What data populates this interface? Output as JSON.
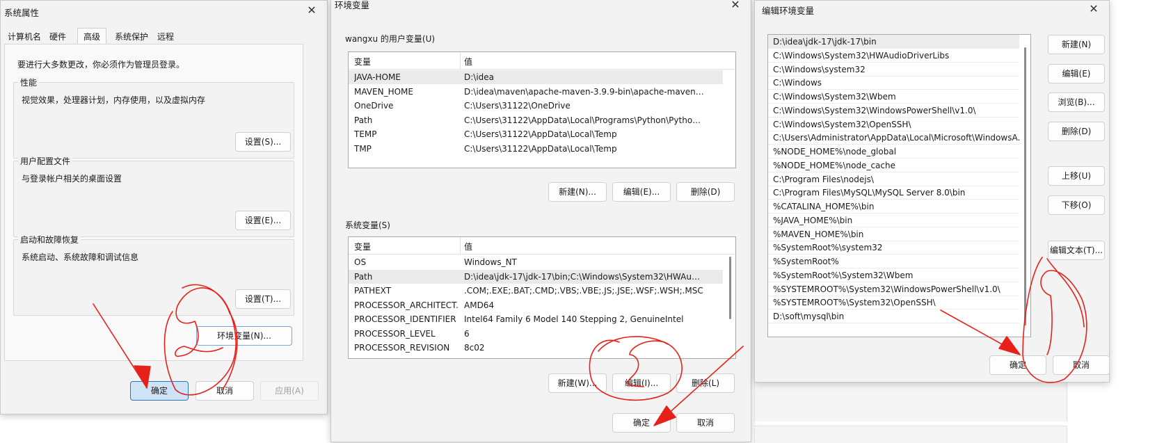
{
  "system_properties": {
    "title": "系统属性",
    "tabs": [
      "计算机名",
      "硬件",
      "高级",
      "系统保护",
      "远程"
    ],
    "active_tab": "高级",
    "admin_note": "要进行大多数更改，你必须作为管理员登录。",
    "performance": {
      "label": "性能",
      "desc": "视觉效果，处理器计划，内存使用，以及虚拟内存",
      "button": "设置(S)..."
    },
    "user_profile": {
      "label": "用户配置文件",
      "desc": "与登录帐户相关的桌面设置",
      "button": "设置(E)..."
    },
    "startup": {
      "label": "启动和故障恢复",
      "desc": "系统启动、系统故障和调试信息",
      "button": "设置(T)..."
    },
    "env_button": "环境变量(N)...",
    "ok": "确定",
    "cancel": "取消",
    "apply": "应用(A)"
  },
  "env_vars": {
    "title": "环境变量",
    "user_section_label": "wangxu 的用户变量(U)",
    "col_var": "变量",
    "col_value": "值",
    "user_vars": [
      {
        "name": "JAVA-HOME",
        "value": "D:\\idea"
      },
      {
        "name": "MAVEN_HOME",
        "value": "D:\\idea\\maven\\apache-maven-3.9.9-bin\\apache-maven-3.9.9"
      },
      {
        "name": "OneDrive",
        "value": "C:\\Users\\31122\\OneDrive"
      },
      {
        "name": "Path",
        "value": "C:\\Users\\31122\\AppData\\Local\\Programs\\Python\\Python313\\..."
      },
      {
        "name": "TEMP",
        "value": "C:\\Users\\31122\\AppData\\Local\\Temp"
      },
      {
        "name": "TMP",
        "value": "C:\\Users\\31122\\AppData\\Local\\Temp"
      }
    ],
    "user_buttons": {
      "new": "新建(N)...",
      "edit": "编辑(E)...",
      "delete": "删除(D)"
    },
    "system_section_label": "系统变量(S)",
    "system_vars": [
      {
        "name": "OS",
        "value": "Windows_NT"
      },
      {
        "name": "Path",
        "value": "D:\\idea\\jdk-17\\jdk-17\\bin;C:\\Windows\\System32\\HWAudioDr..."
      },
      {
        "name": "PATHEXT",
        "value": ".COM;.EXE;.BAT;.CMD;.VBS;.VBE;.JS;.JSE;.WSF;.WSH;.MSC"
      },
      {
        "name": "PROCESSOR_ARCHITECT...",
        "value": "AMD64"
      },
      {
        "name": "PROCESSOR_IDENTIFIER",
        "value": "Intel64 Family 6 Model 140 Stepping 2, GenuineIntel"
      },
      {
        "name": "PROCESSOR_LEVEL",
        "value": "6"
      },
      {
        "name": "PROCESSOR_REVISION",
        "value": "8c02"
      }
    ],
    "system_buttons": {
      "new": "新建(W)...",
      "edit": "编辑(I)...",
      "delete": "删除(L)"
    },
    "ok": "确定",
    "cancel": "取消"
  },
  "edit_env": {
    "title": "编辑环境变量",
    "paths": [
      "D:\\idea\\jdk-17\\jdk-17\\bin",
      "C:\\Windows\\System32\\HWAudioDriverLibs",
      "C:\\Windows\\system32",
      "C:\\Windows",
      "C:\\Windows\\System32\\Wbem",
      "C:\\Windows\\System32\\WindowsPowerShell\\v1.0\\",
      "C:\\Windows\\System32\\OpenSSH\\",
      "C:\\Users\\Administrator\\AppData\\Local\\Microsoft\\WindowsA...",
      "%NODE_HOME%\\node_global",
      "%NODE_HOME%\\node_cache",
      "C:\\Program Files\\nodejs\\",
      "C:\\Program Files\\MySQL\\MySQL Server 8.0\\bin",
      "%CATALINA_HOME%\\bin",
      "%JAVA_HOME%\\bin",
      "%MAVEN_HOME%\\bin",
      "%SystemRoot%\\system32",
      "%SystemRoot%",
      "%SystemRoot%\\System32\\Wbem",
      "%SYSTEMROOT%\\System32\\WindowsPowerShell\\v1.0\\",
      "%SYSTEMROOT%\\System32\\OpenSSH\\",
      "D:\\soft\\mysql\\bin"
    ],
    "buttons": {
      "new": "新建(N)",
      "edit": "编辑(E)",
      "browse": "浏览(B)...",
      "delete": "删除(D)",
      "up": "上移(U)",
      "down": "下移(O)",
      "edit_text": "编辑文本(T)..."
    },
    "ok": "确定",
    "cancel": "取消"
  },
  "colors": {
    "annotation": "#e8201a",
    "primary_button": "#cfe3f7",
    "primary_border": "#2f73c4"
  }
}
